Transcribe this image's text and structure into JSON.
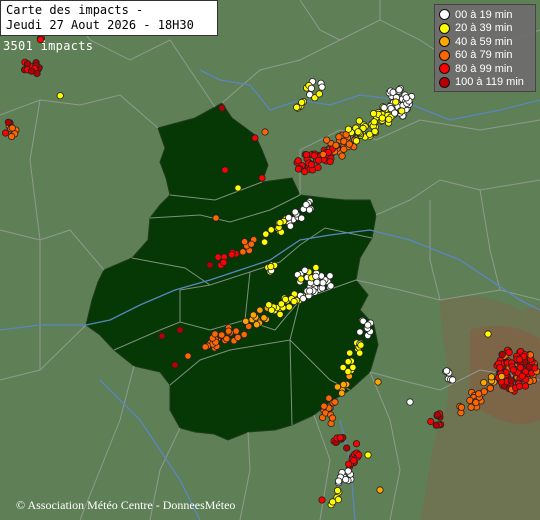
{
  "title": {
    "line1": "Carte des impacts -",
    "line2": "Jeudi 27 Aout 2026 - 18H30"
  },
  "impacts": "3501 impacts",
  "legend": [
    {
      "label": "00 à 19 min",
      "color": "#ffffff"
    },
    {
      "label": "20 à 39 min",
      "color": "#ffff00"
    },
    {
      "label": "40 à 59 min",
      "color": "#ffa500"
    },
    {
      "label": "60 à 79 min",
      "color": "#ff6600"
    },
    {
      "label": "80 à 99 min",
      "color": "#ff0000"
    },
    {
      "label": "100 à 119 min",
      "color": "#b40000"
    }
  ],
  "copyright": "© Association Météo Centre - DonneesMéteo",
  "colors": {
    "land": "#5f7f56",
    "region": "#063806",
    "border": "#9aa89a",
    "river": "#5a86c0"
  }
}
